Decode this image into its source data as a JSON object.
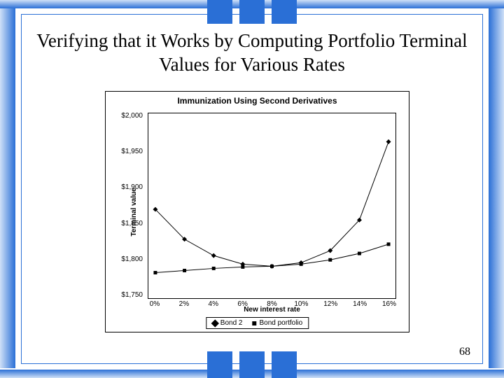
{
  "slide": {
    "title": "Verifying that it Works by Computing Portfolio Terminal Values for Various Rates",
    "page_number": "68"
  },
  "chart_data": {
    "type": "line",
    "title": "Immunization Using Second Derivatives",
    "xlabel": "New interest rate",
    "ylabel": "Terminal value",
    "xlim": [
      0,
      16
    ],
    "ylim": [
      1750,
      2000
    ],
    "x": [
      0,
      2,
      4,
      6,
      8,
      10,
      12,
      14,
      16
    ],
    "x_tick_labels": [
      "0%",
      "2%",
      "4%",
      "6%",
      "8%",
      "10%",
      "12%",
      "14%",
      "16%"
    ],
    "y_ticks": [
      1750,
      1800,
      1850,
      1900,
      1950,
      2000
    ],
    "y_tick_labels": [
      "$1,750",
      "$1,800",
      "$1,850",
      "$1,900",
      "$1,950",
      "$2,000"
    ],
    "series": [
      {
        "name": "Bond 2",
        "marker": "diamond",
        "values": [
          1870,
          1828,
          1805,
          1793,
          1790,
          1795,
          1812,
          1855,
          1965
        ]
      },
      {
        "name": "Bond portfolio",
        "marker": "square",
        "values": [
          1781,
          1784,
          1787,
          1789,
          1790,
          1793,
          1799,
          1808,
          1821
        ]
      }
    ]
  }
}
